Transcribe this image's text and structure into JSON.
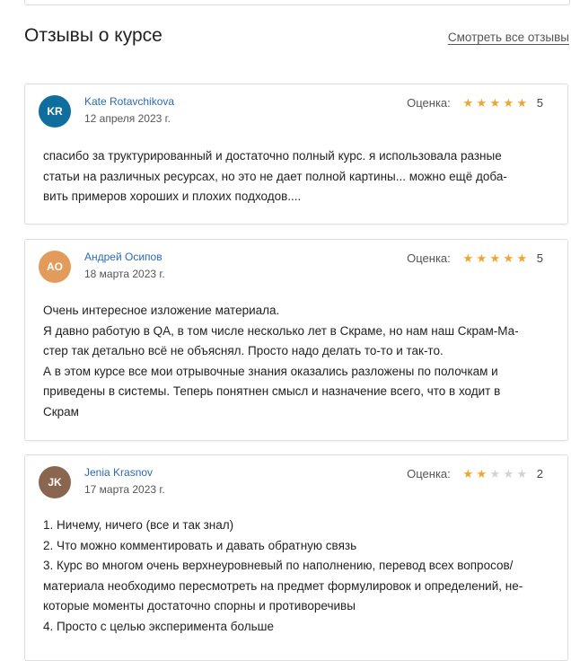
{
  "section": {
    "title": "Отзывы о курсе",
    "see_all_link": "Смотреть все отзывы"
  },
  "rating_label": "Оценка:",
  "colors": {
    "star_filled": "#f0a52e",
    "star_empty": "#d3d3d3",
    "name_link": "#2a6ab3"
  },
  "reviews": [
    {
      "initials": "KR",
      "avatar_color": "#0f6e9e",
      "name": "Kate Rotavchikova",
      "date": "12 апреля 2023 г.",
      "rating": 5,
      "rating_text": "5",
      "lines": [
        "спасибо за труктурированный и достаточно полный курс. я использовала разные",
        "статьи на различных ресурсах, но это не дает полной картины... можно ещё доба-",
        "вить примеров хороших и плохих подходов...."
      ]
    },
    {
      "initials": "AO",
      "avatar_color": "#e39b5b",
      "name": "Андрей Осипов",
      "date": "18 марта 2023 г.",
      "rating": 5,
      "rating_text": "5",
      "lines": [
        "Очень интересное изложение материала.",
        "Я давно работую в QA, в том числе несколько лет в Скраме, но нам наш Скрам-Ма-",
        "стер так детально всё не объяснял. Просто надо делать то-то и так-то.",
        "А в этом курсе все мои отрывочные знания оказались разложены по полочкам и",
        "приведены в системы. Теперь понятнен смысл и назначение всего, что в ходит в",
        "Скрам"
      ]
    },
    {
      "initials": "JK",
      "avatar_color": "#8a6651",
      "name": "Jenia Krasnov",
      "date": "17 марта 2023 г.",
      "rating": 2,
      "rating_text": "2",
      "lines": [
        "1. Ничему, ничего (все и так знал)",
        "2. Что можно комментировать и давать обратную связь",
        "3. Курс во многом очень верхнеуровневый по наполнению, перевод всех вопросов/",
        "материала необходимо пересмотреть на предмет формулировок и определений, не-",
        "которые моменты достаточно спорны и противоречивы",
        "4. Просто с целью эксперимента больше"
      ]
    }
  ]
}
